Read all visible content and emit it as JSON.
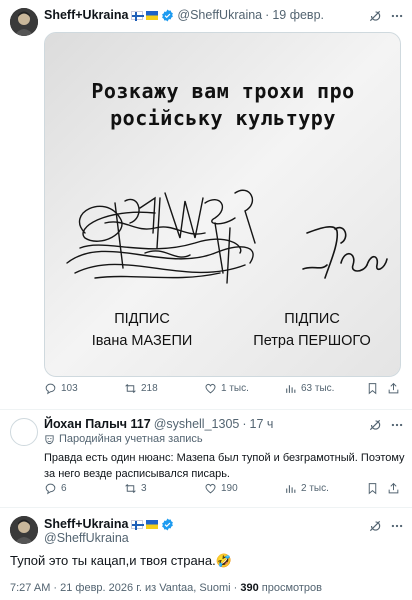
{
  "tweet1": {
    "author_name": "Sheff+Ukraina",
    "handle": "@SheffUkraina",
    "date": "19 февр.",
    "image": {
      "headline_line1": "Розкажу вам трохи про",
      "headline_line2": "російську культуру",
      "caption_left_line1": "ПІДПИС",
      "caption_left_line2": "Івана МАЗЕПИ",
      "caption_right_line1": "ПІДПИС",
      "caption_right_line2": "Петра ПЕРШОГО",
      "signature_right": "Петръ"
    },
    "actions": {
      "replies": "103",
      "retweets": "218",
      "likes": "1 тыс.",
      "views": "63 тыс."
    }
  },
  "reply": {
    "author_name": "Йохан Палыч 117",
    "handle": "@syshell_1305",
    "date": "17 ч",
    "parody_label": "Пародийная учетная запись",
    "text_line1": "Правда есть один нюанс: Мазепа был тупой и безграмотный. Поэтому",
    "text_line2": "за него везде расписывался писарь.",
    "actions": {
      "replies": "6",
      "retweets": "3",
      "likes": "190",
      "views": "2 тыс."
    }
  },
  "tweet2": {
    "author_name": "Sheff+Ukraina",
    "handle": "@SheffUkraina",
    "text": "Тупой это ты кацап,и твоя страна.🤣",
    "meta_time": "7:27 AM · 21 февр. 2026 г. из Vantaa, Suomi · ",
    "views_count": "390",
    "views_label": " просмотров"
  },
  "colors": {
    "muted": "#536471",
    "verified": "#1d9bf0",
    "divider": "#eff3f4",
    "text": "#0f1419"
  },
  "icons": [
    "grok-icon",
    "more-icon",
    "reply-icon",
    "retweet-icon",
    "like-icon",
    "views-icon",
    "bookmark-icon",
    "share-icon",
    "verified-icon",
    "parody-icon"
  ]
}
